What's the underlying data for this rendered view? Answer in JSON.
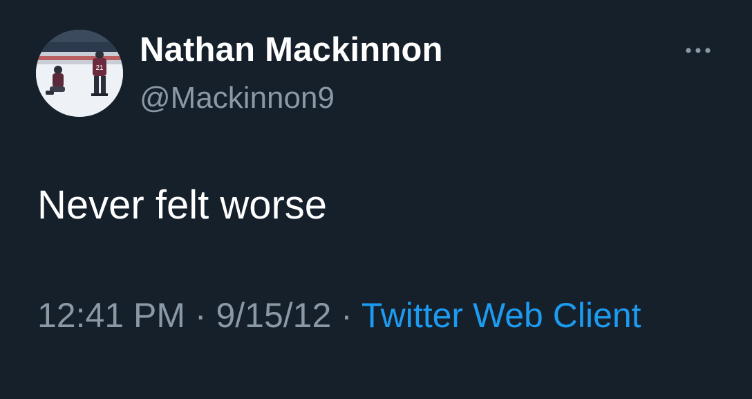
{
  "author": {
    "name": "Nathan Mackinnon",
    "handle": "@Mackinnon9",
    "avatar_jersey_number": "21"
  },
  "tweet": {
    "text": "Never felt worse"
  },
  "meta": {
    "time": "12:41 PM",
    "separator": " · ",
    "date": "9/15/12",
    "source": "Twitter Web Client"
  },
  "icons": {
    "more": "more-horizontal-icon"
  },
  "colors": {
    "background": "#15202b",
    "name": "#ffffff",
    "secondary": "#8b98a5",
    "link": "#1d9bf0"
  }
}
